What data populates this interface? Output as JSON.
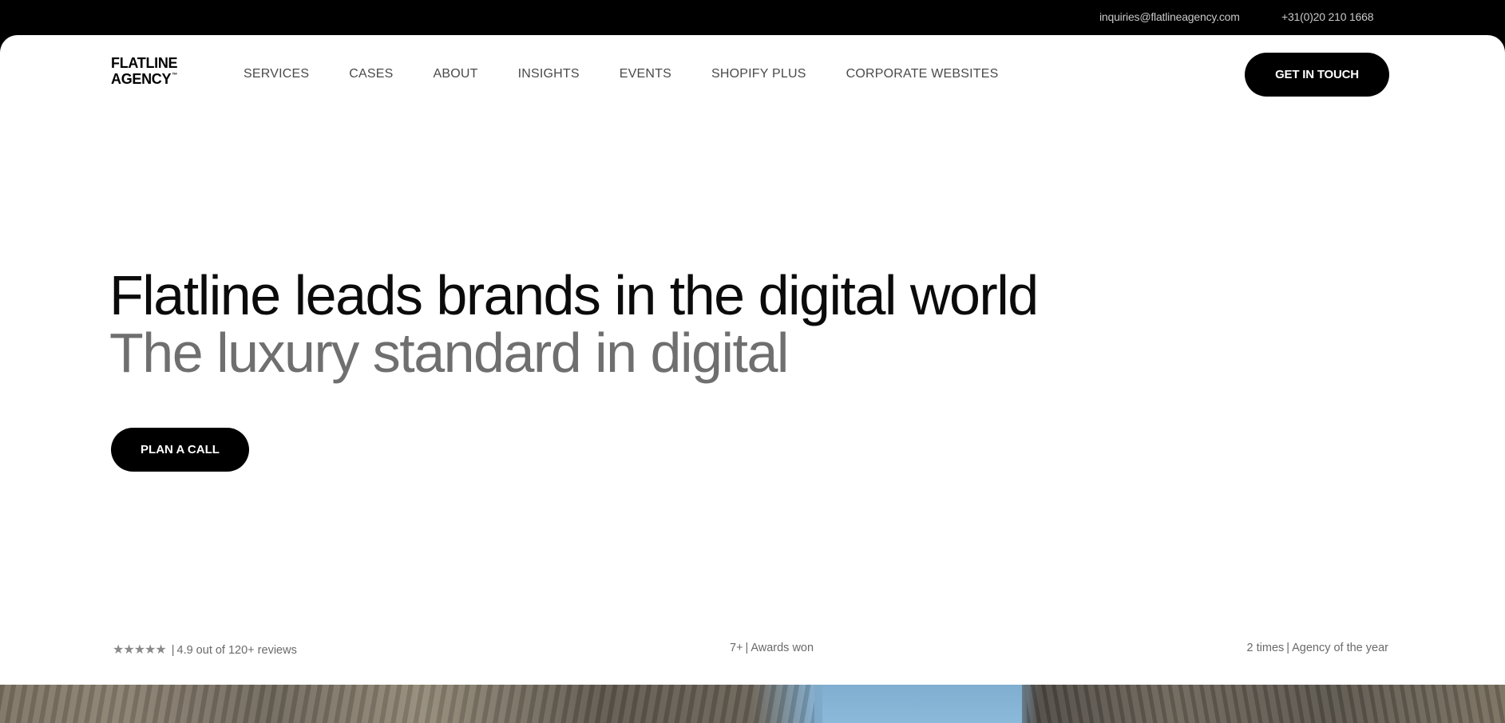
{
  "topbar": {
    "email": "inquiries@flatlineagency.com",
    "phone": "+31(0)20 210 1668"
  },
  "header": {
    "logo_line1": "FLATLINE",
    "logo_line2": "AGENCY",
    "logo_tm": "™",
    "nav": [
      "SERVICES",
      "CASES",
      "ABOUT",
      "INSIGHTS",
      "EVENTS",
      "SHOPIFY PLUS",
      "CORPORATE WEBSITES"
    ],
    "cta_label": "GET IN TOUCH"
  },
  "hero": {
    "title": "Flatline leads brands in the digital world",
    "subtitle": "The luxury standard in digital",
    "cta_label": "PLAN A CALL"
  },
  "stats": {
    "reviews": {
      "stars": "★★★★★",
      "rating": 5,
      "text": "4.9 out of 120+ reviews"
    },
    "awards": {
      "value": "7+",
      "text": "Awards won"
    },
    "agency": {
      "value": "2 times",
      "text": "Agency of the year"
    },
    "separator": "|"
  },
  "colors": {
    "topbar_bg": "#000000",
    "page_bg": "#ffffff",
    "button_bg": "#000000",
    "button_text": "#ffffff",
    "title": "#0b0b0b",
    "subtitle": "#6f6f6f"
  }
}
